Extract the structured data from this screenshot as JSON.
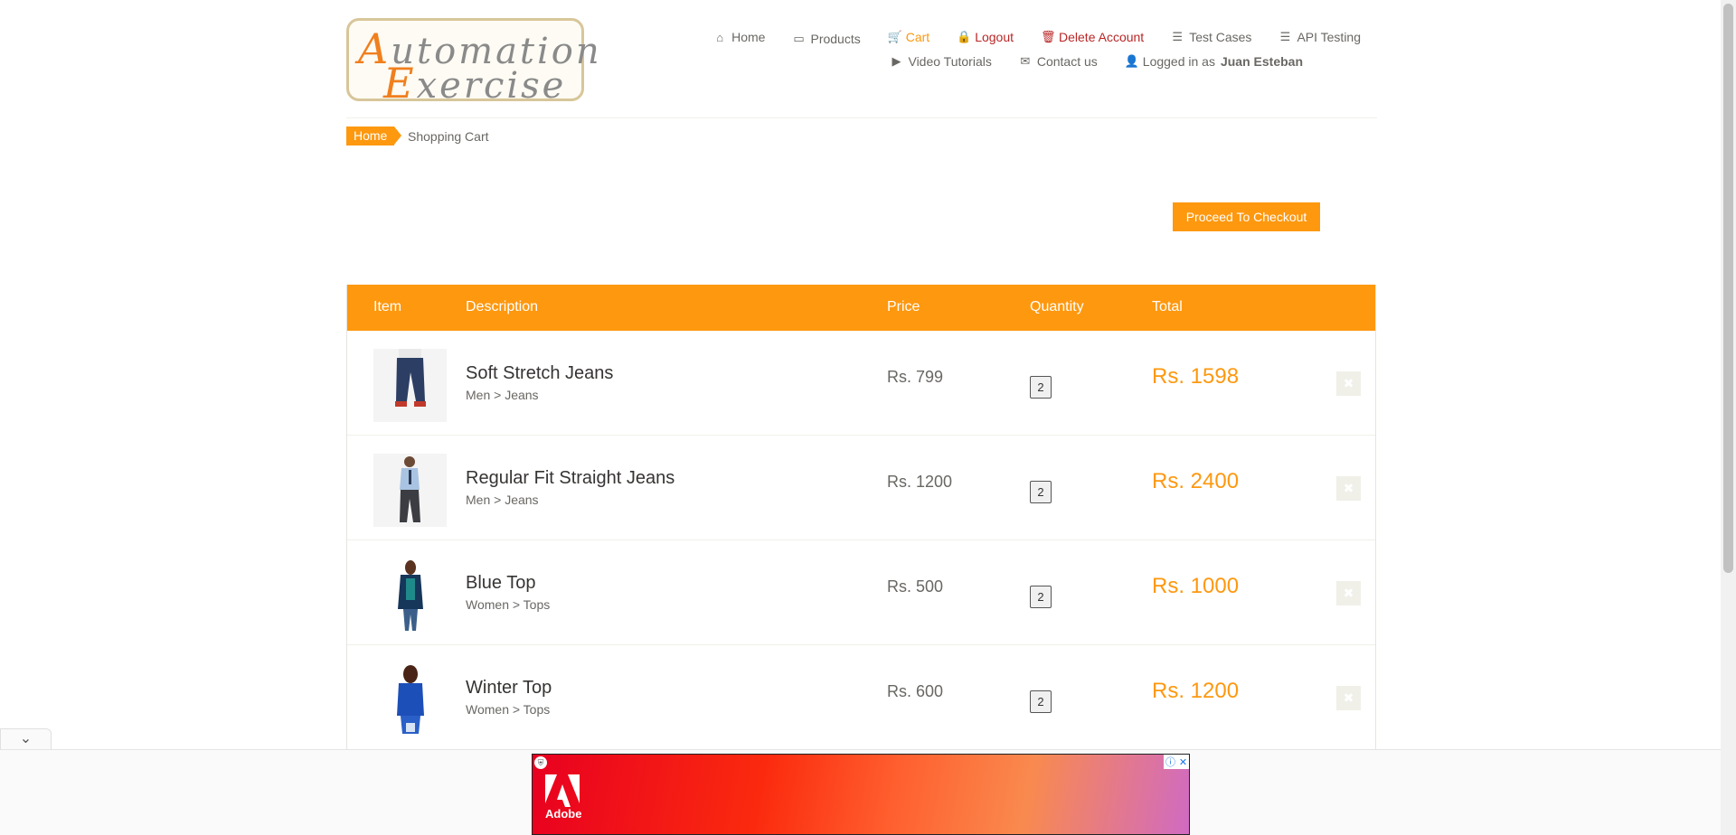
{
  "logo": {
    "line1_initial": "A",
    "line1_rest": "utomation",
    "line2_initial": "E",
    "line2_rest": "xercise"
  },
  "nav": {
    "row1": [
      {
        "icon": "home-icon",
        "glyph": "⌂",
        "label": "Home"
      },
      {
        "icon": "briefcase-icon",
        "glyph": "▭",
        "label": "Products"
      },
      {
        "icon": "cart-icon",
        "glyph": "🛒",
        "label": "Cart"
      },
      {
        "icon": "lock-icon",
        "glyph": "🔒",
        "label": "Logout"
      },
      {
        "icon": "trash-icon",
        "glyph": "🗑",
        "label": "Delete Account"
      },
      {
        "icon": "list-icon",
        "glyph": "☰",
        "label": "Test Cases"
      },
      {
        "icon": "list-icon",
        "glyph": "☰",
        "label": "API Testing"
      }
    ],
    "row2": [
      {
        "icon": "youtube-icon",
        "glyph": "▶",
        "label": "Video Tutorials"
      },
      {
        "icon": "envelope-icon",
        "glyph": "✉",
        "label": "Contact us"
      },
      {
        "icon": "user-icon",
        "glyph": "👤",
        "label": "Logged in as",
        "user": "Juan Esteban"
      }
    ]
  },
  "breadcrumb": {
    "home": "Home",
    "current": "Shopping Cart"
  },
  "checkout": {
    "label": "Proceed To Checkout"
  },
  "table": {
    "headers": {
      "item": "Item",
      "description": "Description",
      "price": "Price",
      "quantity": "Quantity",
      "total": "Total"
    },
    "rows": [
      {
        "name": "Soft Stretch Jeans",
        "category": "Men > Jeans",
        "price": "Rs. 799",
        "quantity": "2",
        "total": "Rs. 1598",
        "delete": "✖"
      },
      {
        "name": "Regular Fit Straight Jeans",
        "category": "Men > Jeans",
        "price": "Rs. 1200",
        "quantity": "2",
        "total": "Rs. 2400",
        "delete": "✖"
      },
      {
        "name": "Blue Top",
        "category": "Women > Tops",
        "price": "Rs. 500",
        "quantity": "2",
        "total": "Rs. 1000",
        "delete": "✖"
      },
      {
        "name": "Winter Top",
        "category": "Women > Tops",
        "price": "Rs. 600",
        "quantity": "2",
        "total": "Rs. 1200",
        "delete": "✖"
      }
    ]
  },
  "ad": {
    "brand": "Adobe",
    "toggle_glyph": "⌄",
    "info_glyph": "ⓘ",
    "close_glyph": "✕"
  },
  "colors": {
    "accent": "#FE980F",
    "danger": "#b92626",
    "text": "#696763"
  }
}
